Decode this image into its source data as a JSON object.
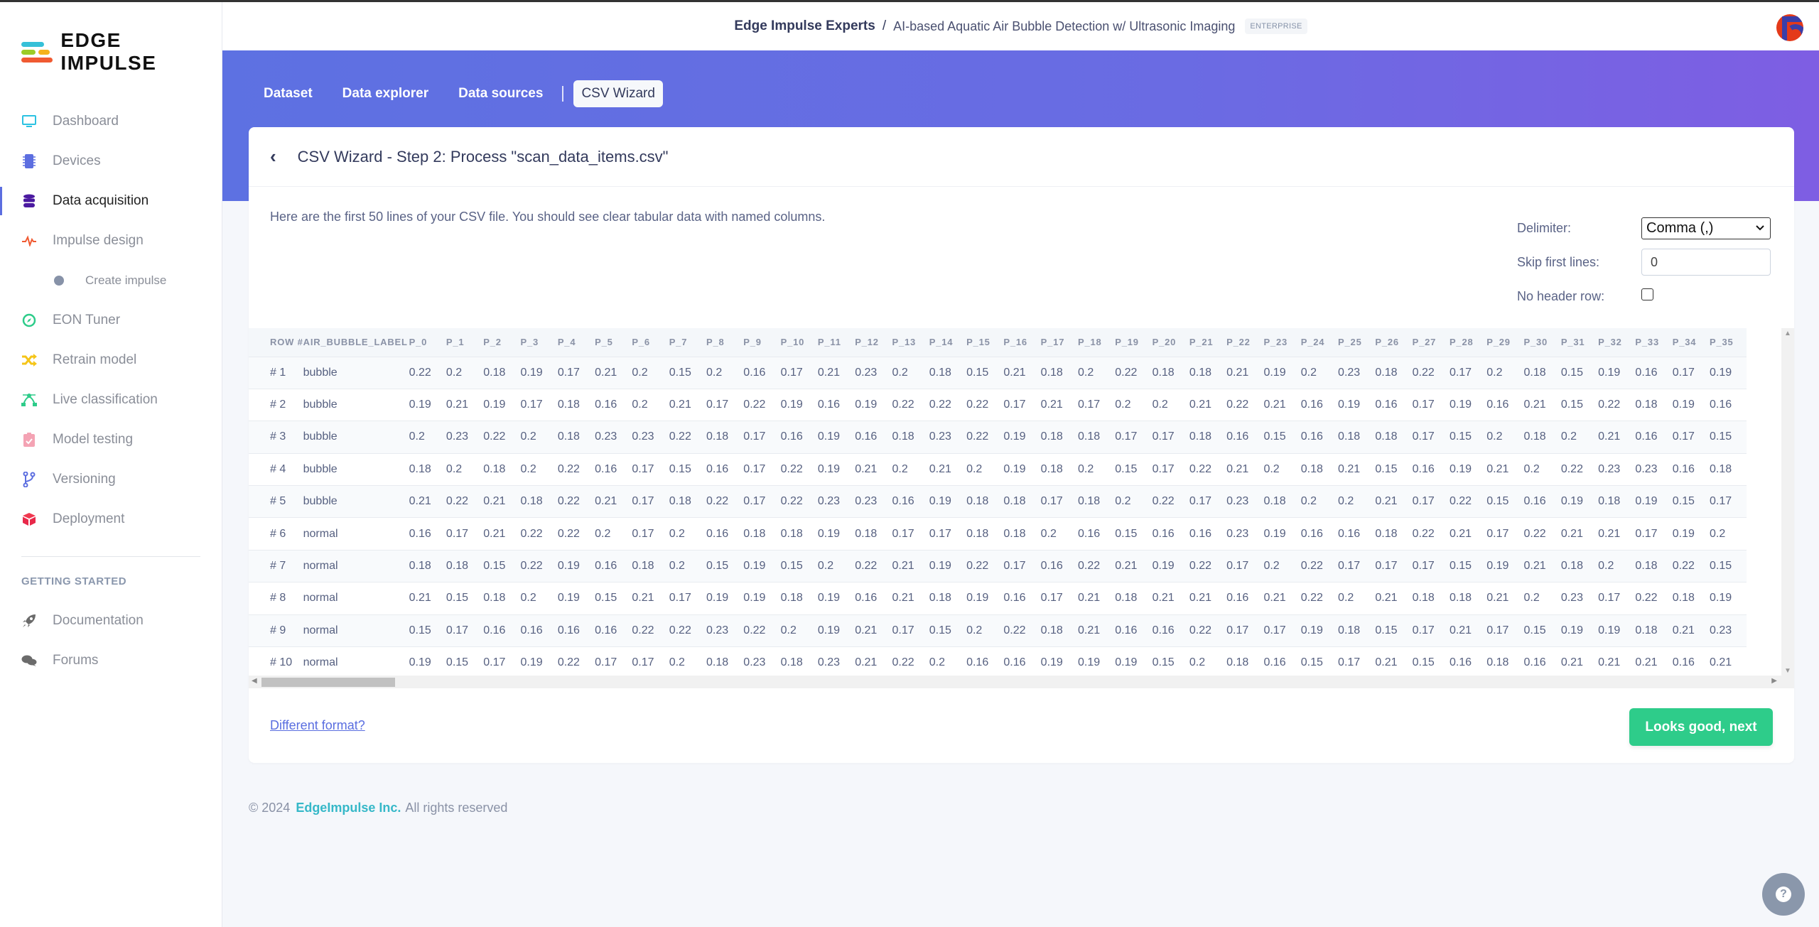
{
  "brand": {
    "name": "EDGE IMPULSE"
  },
  "sidebar": {
    "items": [
      {
        "label": "Dashboard",
        "icon": "monitor-icon"
      },
      {
        "label": "Devices",
        "icon": "chip-icon"
      },
      {
        "label": "Data acquisition",
        "icon": "database-icon",
        "active": true
      },
      {
        "label": "Impulse design",
        "icon": "pulse-icon"
      },
      {
        "label": "Create impulse",
        "icon": "dot-icon",
        "sub": true
      },
      {
        "label": "EON Tuner",
        "icon": "compass-icon"
      },
      {
        "label": "Retrain model",
        "icon": "shuffle-icon"
      },
      {
        "label": "Live classification",
        "icon": "bezier-icon"
      },
      {
        "label": "Model testing",
        "icon": "clipboard-check-icon"
      },
      {
        "label": "Versioning",
        "icon": "branch-icon"
      },
      {
        "label": "Deployment",
        "icon": "cube-icon"
      }
    ],
    "section_title": "GETTING STARTED",
    "section_items": [
      {
        "label": "Documentation",
        "icon": "rocket-icon"
      },
      {
        "label": "Forums",
        "icon": "comments-icon"
      }
    ]
  },
  "header": {
    "org": "Edge Impulse Experts",
    "separator": "/",
    "project": "AI-based Aquatic Air Bubble Detection w/ Ultrasonic Imaging",
    "badge": "ENTERPRISE"
  },
  "tabs": [
    {
      "label": "Dataset"
    },
    {
      "label": "Data explorer"
    },
    {
      "label": "Data sources"
    },
    {
      "label": "CSV Wizard",
      "active": true
    }
  ],
  "card": {
    "back_icon": "‹",
    "title": "CSV Wizard - Step 2: Process \"scan_data_items.csv\"",
    "intro": "Here are the first 50 lines of your CSV file. You should see clear tabular data with named columns.",
    "settings": {
      "delimiter_label": "Delimiter:",
      "delimiter_value": "Comma (,)",
      "skip_label": "Skip first lines:",
      "skip_value": "0",
      "no_header_label": "No header row:",
      "no_header_checked": false
    },
    "table": {
      "columns": [
        "ROW #",
        "AIR_BUBBLE_LABEL",
        "P_0",
        "P_1",
        "P_2",
        "P_3",
        "P_4",
        "P_5",
        "P_6",
        "P_7",
        "P_8",
        "P_9",
        "P_10",
        "P_11",
        "P_12",
        "P_13",
        "P_14",
        "P_15",
        "P_16",
        "P_17",
        "P_18",
        "P_19",
        "P_20",
        "P_21",
        "P_22",
        "P_23",
        "P_24",
        "P_25",
        "P_26",
        "P_27",
        "P_28",
        "P_29",
        "P_30",
        "P_31",
        "P_32",
        "P_33",
        "P_34",
        "P_35"
      ],
      "rows": [
        [
          "# 1",
          "bubble",
          "0.22",
          "0.2",
          "0.18",
          "0.19",
          "0.17",
          "0.21",
          "0.2",
          "0.15",
          "0.2",
          "0.16",
          "0.17",
          "0.21",
          "0.23",
          "0.2",
          "0.18",
          "0.15",
          "0.21",
          "0.18",
          "0.2",
          "0.22",
          "0.18",
          "0.18",
          "0.21",
          "0.19",
          "0.2",
          "0.23",
          "0.18",
          "0.22",
          "0.17",
          "0.2",
          "0.18",
          "0.15",
          "0.19",
          "0.16",
          "0.17",
          "0.19"
        ],
        [
          "# 2",
          "bubble",
          "0.19",
          "0.21",
          "0.19",
          "0.17",
          "0.18",
          "0.16",
          "0.2",
          "0.21",
          "0.17",
          "0.22",
          "0.19",
          "0.16",
          "0.19",
          "0.22",
          "0.22",
          "0.22",
          "0.17",
          "0.21",
          "0.17",
          "0.2",
          "0.2",
          "0.21",
          "0.22",
          "0.21",
          "0.16",
          "0.19",
          "0.16",
          "0.17",
          "0.19",
          "0.16",
          "0.21",
          "0.15",
          "0.22",
          "0.18",
          "0.19",
          "0.16"
        ],
        [
          "# 3",
          "bubble",
          "0.2",
          "0.23",
          "0.22",
          "0.2",
          "0.18",
          "0.23",
          "0.23",
          "0.22",
          "0.18",
          "0.17",
          "0.16",
          "0.19",
          "0.16",
          "0.18",
          "0.23",
          "0.22",
          "0.19",
          "0.18",
          "0.18",
          "0.17",
          "0.17",
          "0.18",
          "0.16",
          "0.15",
          "0.16",
          "0.18",
          "0.18",
          "0.17",
          "0.15",
          "0.2",
          "0.18",
          "0.2",
          "0.21",
          "0.16",
          "0.17",
          "0.15"
        ],
        [
          "# 4",
          "bubble",
          "0.18",
          "0.2",
          "0.18",
          "0.2",
          "0.22",
          "0.16",
          "0.17",
          "0.15",
          "0.16",
          "0.17",
          "0.22",
          "0.19",
          "0.21",
          "0.2",
          "0.21",
          "0.2",
          "0.19",
          "0.18",
          "0.2",
          "0.15",
          "0.17",
          "0.22",
          "0.21",
          "0.2",
          "0.18",
          "0.21",
          "0.15",
          "0.16",
          "0.19",
          "0.21",
          "0.2",
          "0.22",
          "0.23",
          "0.23",
          "0.16",
          "0.18"
        ],
        [
          "# 5",
          "bubble",
          "0.21",
          "0.22",
          "0.21",
          "0.18",
          "0.22",
          "0.21",
          "0.17",
          "0.18",
          "0.22",
          "0.17",
          "0.22",
          "0.23",
          "0.23",
          "0.16",
          "0.19",
          "0.18",
          "0.18",
          "0.17",
          "0.18",
          "0.2",
          "0.22",
          "0.17",
          "0.23",
          "0.18",
          "0.2",
          "0.2",
          "0.21",
          "0.17",
          "0.22",
          "0.15",
          "0.16",
          "0.19",
          "0.18",
          "0.19",
          "0.15",
          "0.17"
        ],
        [
          "# 6",
          "normal",
          "0.16",
          "0.17",
          "0.21",
          "0.22",
          "0.22",
          "0.2",
          "0.17",
          "0.2",
          "0.16",
          "0.18",
          "0.18",
          "0.19",
          "0.18",
          "0.17",
          "0.17",
          "0.18",
          "0.18",
          "0.2",
          "0.16",
          "0.15",
          "0.16",
          "0.16",
          "0.23",
          "0.19",
          "0.16",
          "0.16",
          "0.18",
          "0.22",
          "0.21",
          "0.17",
          "0.22",
          "0.21",
          "0.21",
          "0.17",
          "0.19",
          "0.2"
        ],
        [
          "# 7",
          "normal",
          "0.18",
          "0.18",
          "0.15",
          "0.22",
          "0.19",
          "0.16",
          "0.18",
          "0.2",
          "0.15",
          "0.19",
          "0.15",
          "0.2",
          "0.22",
          "0.21",
          "0.19",
          "0.22",
          "0.17",
          "0.16",
          "0.22",
          "0.21",
          "0.19",
          "0.22",
          "0.17",
          "0.2",
          "0.22",
          "0.17",
          "0.17",
          "0.17",
          "0.15",
          "0.19",
          "0.21",
          "0.18",
          "0.2",
          "0.18",
          "0.22",
          "0.15"
        ],
        [
          "# 8",
          "normal",
          "0.21",
          "0.15",
          "0.18",
          "0.2",
          "0.19",
          "0.15",
          "0.21",
          "0.17",
          "0.19",
          "0.19",
          "0.18",
          "0.19",
          "0.16",
          "0.21",
          "0.18",
          "0.19",
          "0.16",
          "0.17",
          "0.21",
          "0.18",
          "0.21",
          "0.21",
          "0.16",
          "0.21",
          "0.22",
          "0.2",
          "0.21",
          "0.18",
          "0.18",
          "0.21",
          "0.2",
          "0.23",
          "0.17",
          "0.22",
          "0.18",
          "0.19"
        ],
        [
          "# 9",
          "normal",
          "0.15",
          "0.17",
          "0.16",
          "0.16",
          "0.16",
          "0.16",
          "0.22",
          "0.22",
          "0.23",
          "0.22",
          "0.2",
          "0.19",
          "0.21",
          "0.17",
          "0.15",
          "0.2",
          "0.22",
          "0.18",
          "0.21",
          "0.16",
          "0.16",
          "0.22",
          "0.17",
          "0.17",
          "0.19",
          "0.18",
          "0.15",
          "0.17",
          "0.21",
          "0.17",
          "0.15",
          "0.19",
          "0.19",
          "0.18",
          "0.21",
          "0.23"
        ],
        [
          "# 10",
          "normal",
          "0.19",
          "0.15",
          "0.17",
          "0.19",
          "0.22",
          "0.17",
          "0.17",
          "0.2",
          "0.18",
          "0.23",
          "0.18",
          "0.23",
          "0.21",
          "0.22",
          "0.2",
          "0.16",
          "0.16",
          "0.19",
          "0.19",
          "0.19",
          "0.15",
          "0.2",
          "0.18",
          "0.16",
          "0.15",
          "0.17",
          "0.21",
          "0.15",
          "0.16",
          "0.18",
          "0.16",
          "0.21",
          "0.21",
          "0.21",
          "0.16",
          "0.21"
        ]
      ]
    },
    "different_format_link": "Different format?",
    "next_button": "Looks good, next"
  },
  "footer": {
    "copyright": "© 2024",
    "company": "EdgeImpulse Inc.",
    "rights": "All rights reserved"
  },
  "help_button": {
    "icon": "question-icon",
    "glyph": "?"
  },
  "colors": {
    "accent": "#5d71e2",
    "success": "#2ecc8a",
    "link": "#5a6ee0",
    "footer_brand": "#36b8c8"
  }
}
